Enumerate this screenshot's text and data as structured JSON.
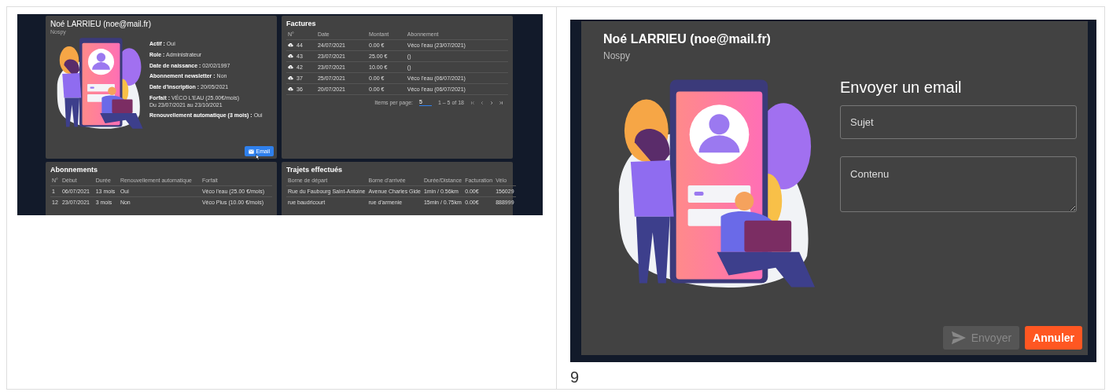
{
  "admin_page": {
    "profile": {
      "name": "Noé LARRIEU (noe@mail.fr)",
      "company": "Nospy",
      "fields": [
        {
          "text": "**Actif :** Oui"
        },
        {
          "text": "**Role :** Administrateur"
        },
        {
          "text": "**Date de naissance :** 02/02/1997"
        },
        {
          "text": "**Abonnement newsletter :** Non"
        },
        {
          "text": "**Date d'inscription :** 20/05/2021"
        },
        {
          "text": "**Forfait :** VÉCO L'EAU (25.00€/mois)",
          "detail": "Du 23/07/2021 au 23/10/2021"
        },
        {
          "text": "**Renouvellement automatique (3 mois) :** Oui"
        }
      ],
      "email_button": "Email"
    },
    "invoices": {
      "title": "Factures",
      "columns": [
        "N°",
        "Date",
        "Montant",
        "Abonnement"
      ],
      "rows": [
        {
          "cells": [
            "44",
            "24/07/2021",
            "0.00 €",
            "Véco l'eau (23/07/2021)"
          ]
        },
        {
          "cells": [
            "43",
            "23/07/2021",
            "25.00 €",
            "()"
          ]
        },
        {
          "cells": [
            "42",
            "23/07/2021",
            "10.00 €",
            "()"
          ]
        },
        {
          "cells": [
            "37",
            "25/07/2021",
            "0.00 €",
            "Véco l'eau (06/07/2021)"
          ]
        },
        {
          "cells": [
            "36",
            "20/07/2021",
            "0.00 €",
            "Véco l'eau (06/07/2021)"
          ]
        }
      ],
      "pagination": {
        "label": "Items per page:",
        "per_page": "5",
        "range": "1 – 5 of 18"
      }
    },
    "subscriptions": {
      "title": "Abonnements",
      "columns": [
        "N°",
        "Début",
        "Durée",
        "Renouvellement automatique",
        "Forfait"
      ],
      "rows": [
        {
          "cells": [
            "1",
            "06/07/2021",
            "13 mois",
            "Oui",
            "Véco l'eau (25.00 €/mois)"
          ]
        },
        {
          "cells": [
            "12",
            "23/07/2021",
            "3 mois",
            "Non",
            "Véco Plus (10.00 €/mois)"
          ]
        }
      ]
    },
    "trips": {
      "title": "Trajets effectués",
      "columns": [
        "Borne de départ",
        "Borne d'arrivée",
        "Durée/Distance",
        "Facturation",
        "Vélo"
      ],
      "rows": [
        {
          "cells": [
            "Rue du Faubourg Saint-Antoine",
            "Avenue Charles Gide",
            "1min / 0.56km",
            "0.00€",
            "156029"
          ]
        },
        {
          "cells": [
            "rue baudricourt",
            "rue d'armenie",
            "15min / 0.75km",
            "0.00€",
            "888999"
          ]
        }
      ]
    }
  },
  "email_dialog": {
    "name": "Noé LARRIEU (noe@mail.fr)",
    "company": "Nospy",
    "title": "Envoyer un email",
    "fields": [
      {
        "kind": "input",
        "placeholder": "Sujet"
      },
      {
        "kind": "textarea",
        "placeholder": "Contenu"
      }
    ],
    "buttons": [
      {
        "label": "Envoyer",
        "kind": "send",
        "disabled": true
      },
      {
        "label": "Annuler",
        "kind": "cancel",
        "disabled": false
      }
    ]
  },
  "caption": "9"
}
